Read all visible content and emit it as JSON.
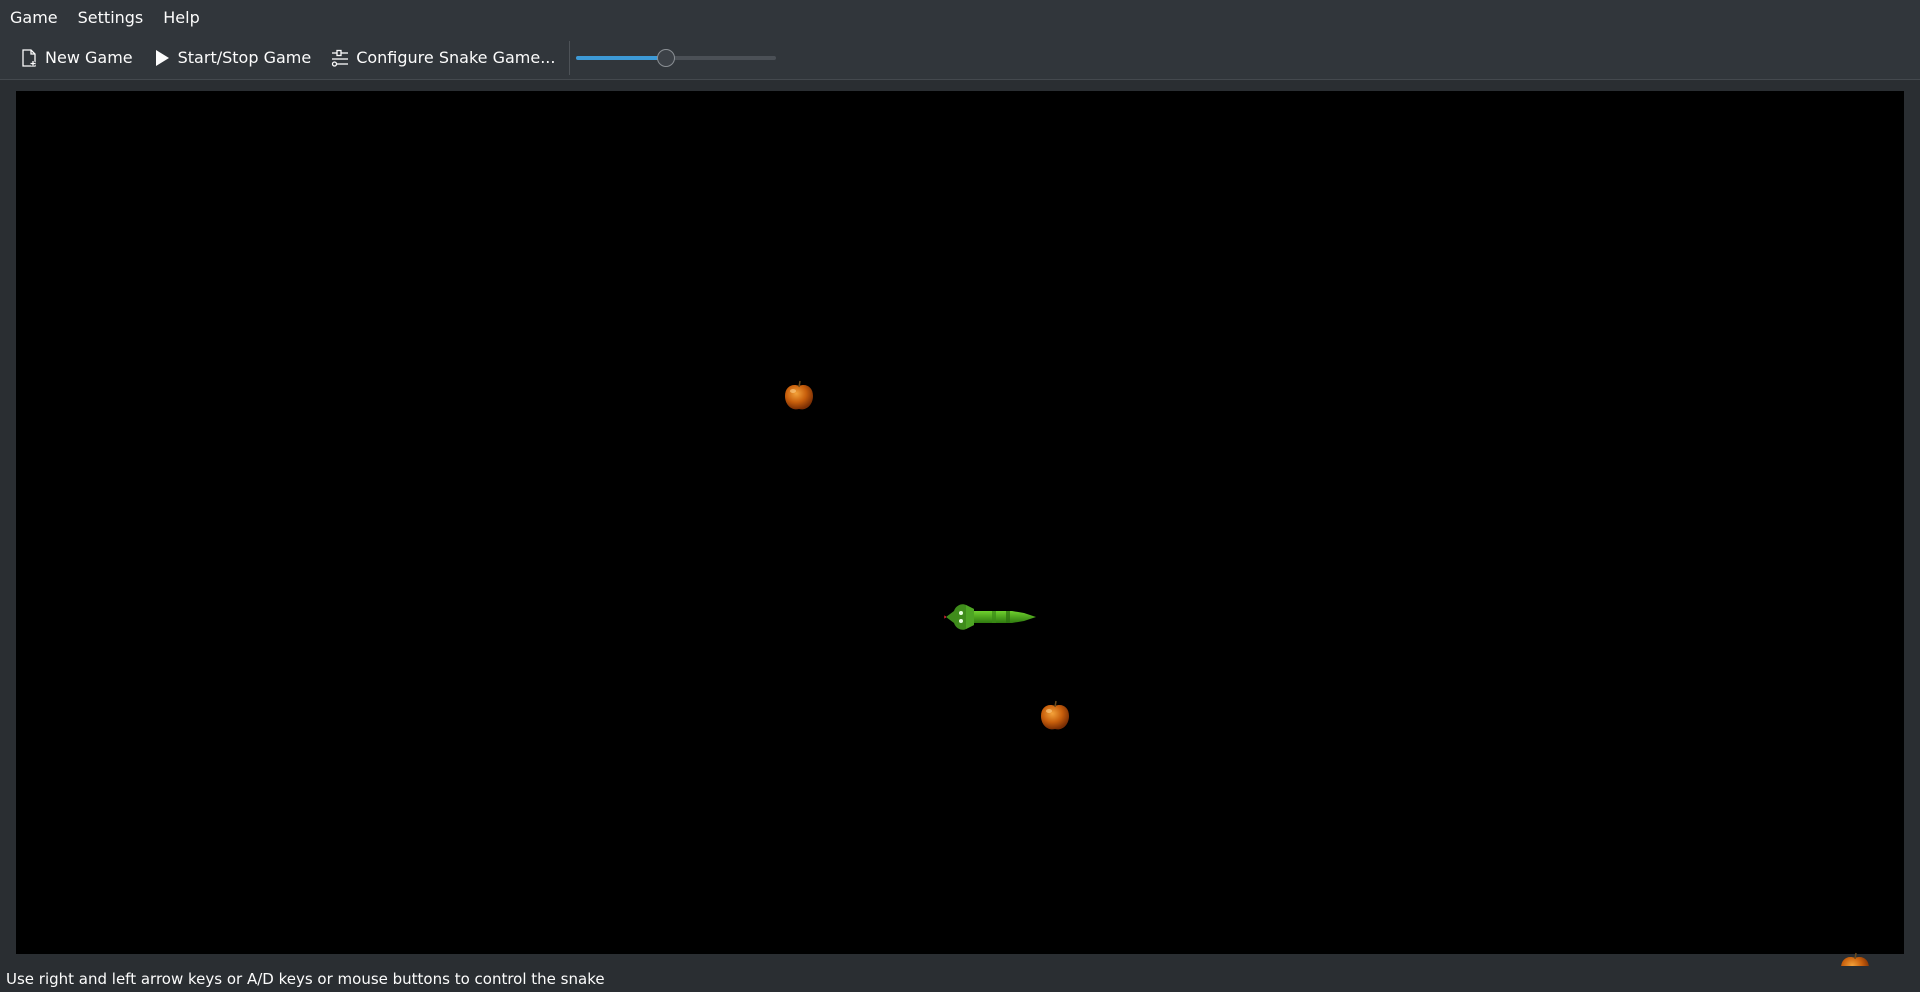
{
  "menubar": {
    "items": [
      {
        "label": "Game"
      },
      {
        "label": "Settings"
      },
      {
        "label": "Help"
      }
    ]
  },
  "toolbar": {
    "new_game": {
      "label": "New Game",
      "icon": "new-document-icon"
    },
    "start_stop": {
      "label": "Start/Stop Game",
      "icon": "play-icon"
    },
    "configure": {
      "label": "Configure Snake Game...",
      "icon": "configure-sliders-icon"
    },
    "speed_slider": {
      "value_fraction": 0.45,
      "accent_color": "#3d9ad6"
    }
  },
  "game": {
    "background_color": "#000000",
    "apples": [
      {
        "name": "apple",
        "icon": "apple-icon"
      },
      {
        "name": "apple",
        "icon": "apple-icon"
      },
      {
        "name": "apple",
        "icon": "apple-icon"
      }
    ],
    "snake": {
      "icon": "snake-icon",
      "direction": "left",
      "color": "#4caf1e"
    }
  },
  "statusbar": {
    "text": "Use right and left arrow keys or A/D keys or mouse buttons to control the snake"
  }
}
